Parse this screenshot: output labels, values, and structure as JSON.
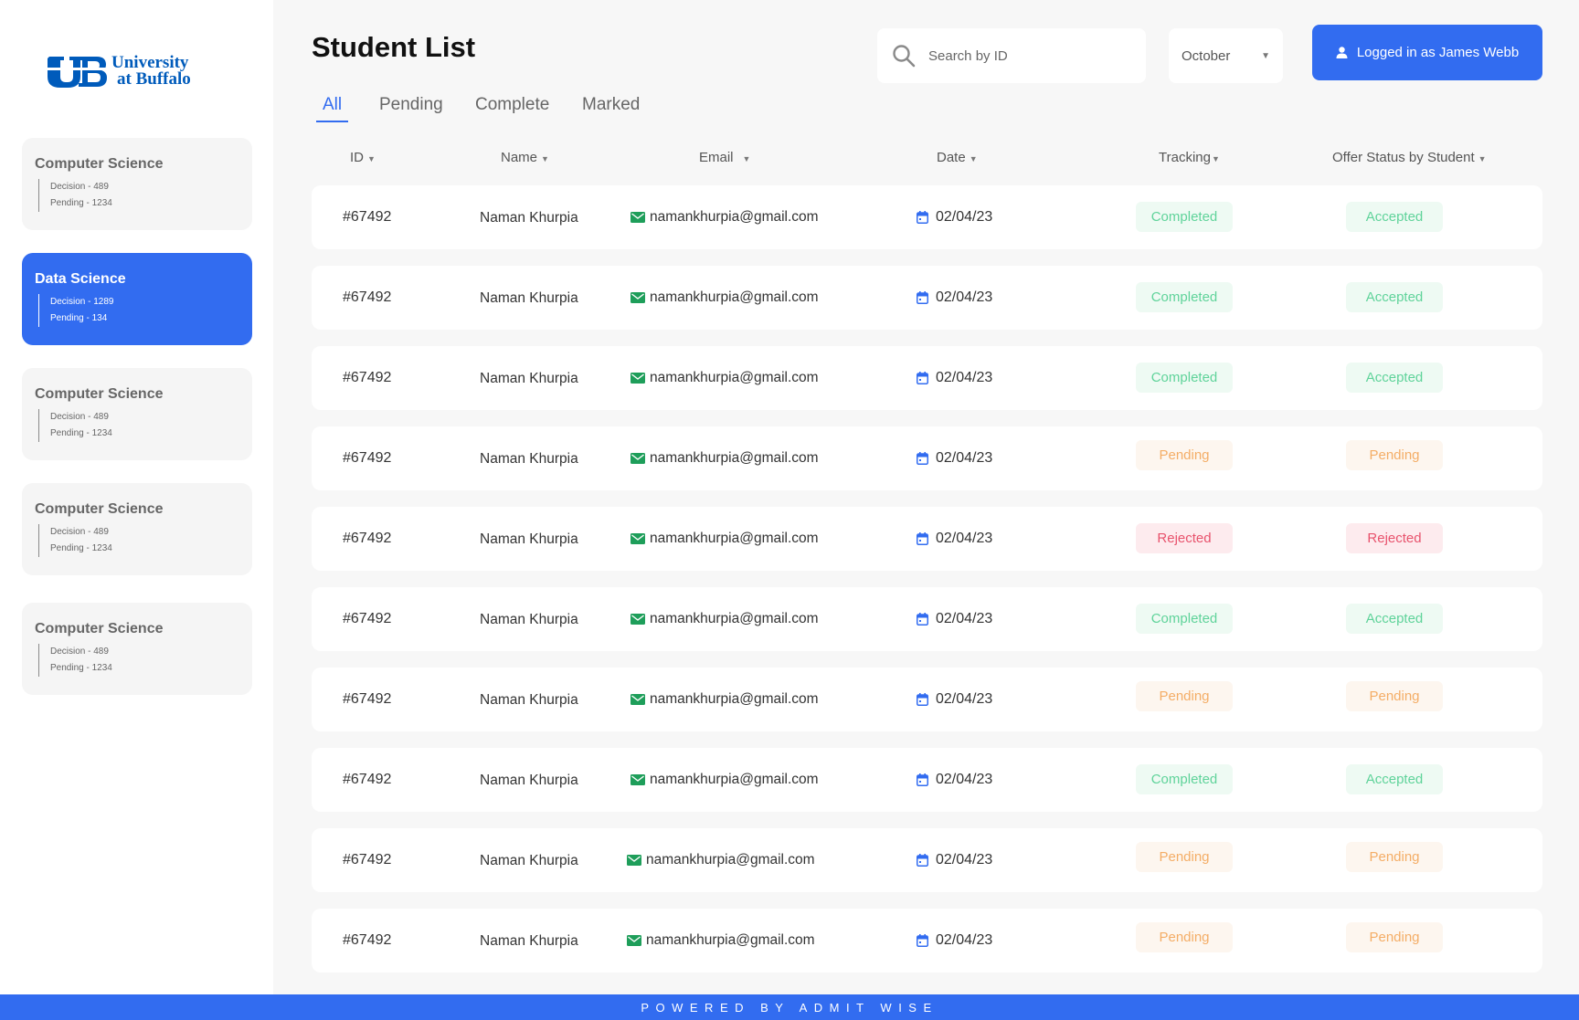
{
  "brand": {
    "line1": "University",
    "line2": "at Buffalo"
  },
  "sidebar": {
    "items": [
      {
        "title": "Computer Science",
        "decision": "Decision - 489",
        "pending": "Pending - 1234"
      },
      {
        "title": "Data Science",
        "decision": "Decision - 1289",
        "pending": "Pending - 134"
      },
      {
        "title": "Computer Science",
        "decision": "Decision - 489",
        "pending": "Pending - 1234"
      },
      {
        "title": "Computer Science",
        "decision": "Decision - 489",
        "pending": "Pending - 1234"
      },
      {
        "title": "Computer Science",
        "decision": "Decision - 489",
        "pending": "Pending - 1234"
      }
    ],
    "active_index": 1
  },
  "header": {
    "title": "Student List",
    "search_placeholder": "Search by ID",
    "month": "October",
    "login_label": "Logged in as James Webb"
  },
  "tabs": [
    "All",
    "Pending",
    "Complete",
    "Marked"
  ],
  "active_tab": "All",
  "table": {
    "columns": [
      "ID",
      "Name",
      "Email",
      "Date",
      "Tracking",
      "Offer Status by Student"
    ],
    "rows": [
      {
        "id": "#67492",
        "name": "Naman Khurpia",
        "email": "namankhurpia@gmail.com",
        "date": "02/04/23",
        "tracking": "Completed",
        "offer": "Accepted"
      },
      {
        "id": "#67492",
        "name": "Naman Khurpia",
        "email": "namankhurpia@gmail.com",
        "date": "02/04/23",
        "tracking": "Completed",
        "offer": "Accepted"
      },
      {
        "id": "#67492",
        "name": "Naman Khurpia",
        "email": "namankhurpia@gmail.com",
        "date": "02/04/23",
        "tracking": "Completed",
        "offer": "Accepted"
      },
      {
        "id": "#67492",
        "name": "Naman Khurpia",
        "email": "namankhurpia@gmail.com",
        "date": "02/04/23",
        "tracking": "Pending",
        "offer": "Pending"
      },
      {
        "id": "#67492",
        "name": "Naman Khurpia",
        "email": "namankhurpia@gmail.com",
        "date": "02/04/23",
        "tracking": "Rejected",
        "offer": "Rejected"
      },
      {
        "id": "#67492",
        "name": "Naman Khurpia",
        "email": "namankhurpia@gmail.com",
        "date": "02/04/23",
        "tracking": "Completed",
        "offer": "Accepted"
      },
      {
        "id": "#67492",
        "name": "Naman Khurpia",
        "email": "namankhurpia@gmail.com",
        "date": "02/04/23",
        "tracking": "Pending",
        "offer": "Pending"
      },
      {
        "id": "#67492",
        "name": "Naman Khurpia",
        "email": "namankhurpia@gmail.com",
        "date": "02/04/23",
        "tracking": "Completed",
        "offer": "Accepted"
      },
      {
        "id": "#67492",
        "name": "Naman Khurpia",
        "email": "namankhurpia@gmail.com",
        "date": "02/04/23",
        "tracking": "Pending",
        "offer": "Pending"
      },
      {
        "id": "#67492",
        "name": "Naman Khurpia",
        "email": "namankhurpia@gmail.com",
        "date": "02/04/23",
        "tracking": "Pending",
        "offer": "Pending"
      }
    ]
  },
  "status_colors": {
    "Completed": "#5fd39a",
    "Accepted": "#5fd39a",
    "Pending": "#f4ad66",
    "Rejected": "#e8536d"
  },
  "accent_color": "#326cf0",
  "footer": {
    "text": "POWERED BY ADMIT WISE"
  },
  "icons": {
    "search": "search-icon",
    "caret": "caret-down-icon",
    "user": "user-icon",
    "email": "envelope-icon",
    "date": "calendar-icon",
    "logo": "ub-logo-icon"
  }
}
